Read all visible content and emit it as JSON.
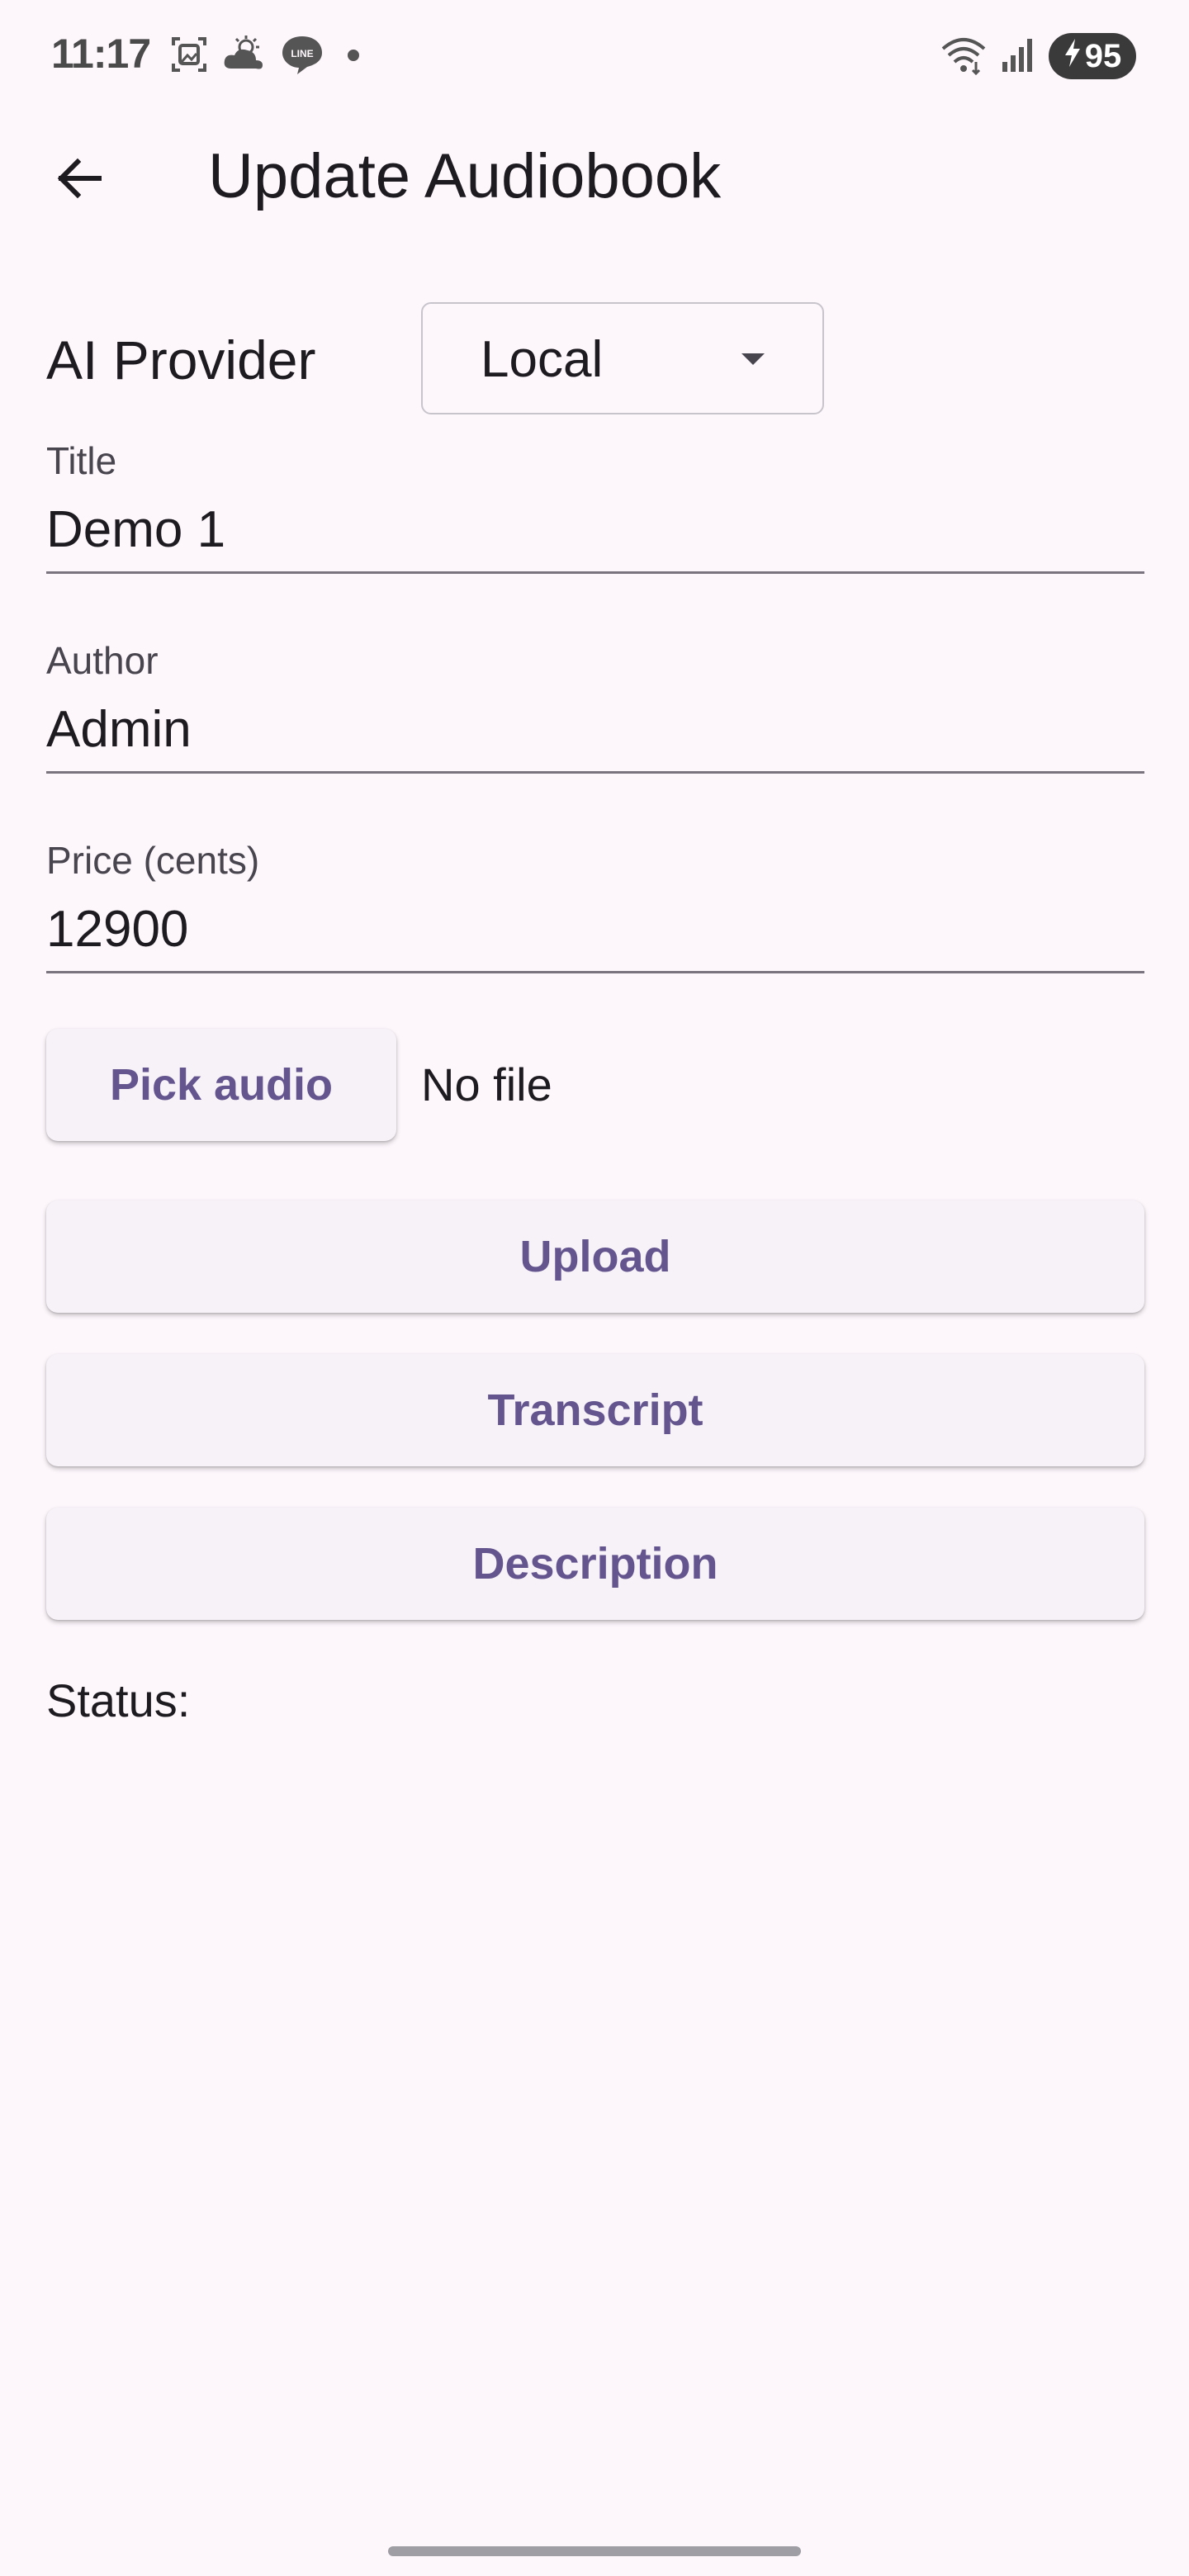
{
  "status_bar": {
    "time": "11:17",
    "battery": "95",
    "left_icons": [
      "screenshot-icon",
      "weather-icon",
      "line-app-icon",
      "dot-icon"
    ],
    "right_icons": [
      "wifi-icon",
      "signal-icon",
      "battery-icon"
    ]
  },
  "app_bar": {
    "title": "Update Audiobook",
    "back_icon": "arrow-back-icon"
  },
  "form": {
    "provider": {
      "label": "AI Provider",
      "selected": "Local"
    },
    "title_field": {
      "label": "Title",
      "value": "Demo 1"
    },
    "author_field": {
      "label": "Author",
      "value": "Admin"
    },
    "price_field": {
      "label": "Price (cents)",
      "value": "12900"
    }
  },
  "actions": {
    "pick_audio": "Pick audio",
    "file_status": "No file",
    "upload": "Upload",
    "transcript": "Transcript",
    "description": "Description"
  },
  "status": {
    "label": "Status:",
    "value": ""
  },
  "colors": {
    "background": "#fdf7fc",
    "accent": "#65558f",
    "button_bg": "#f7f2f8",
    "text": "#1d1b20",
    "label": "#49454f"
  }
}
